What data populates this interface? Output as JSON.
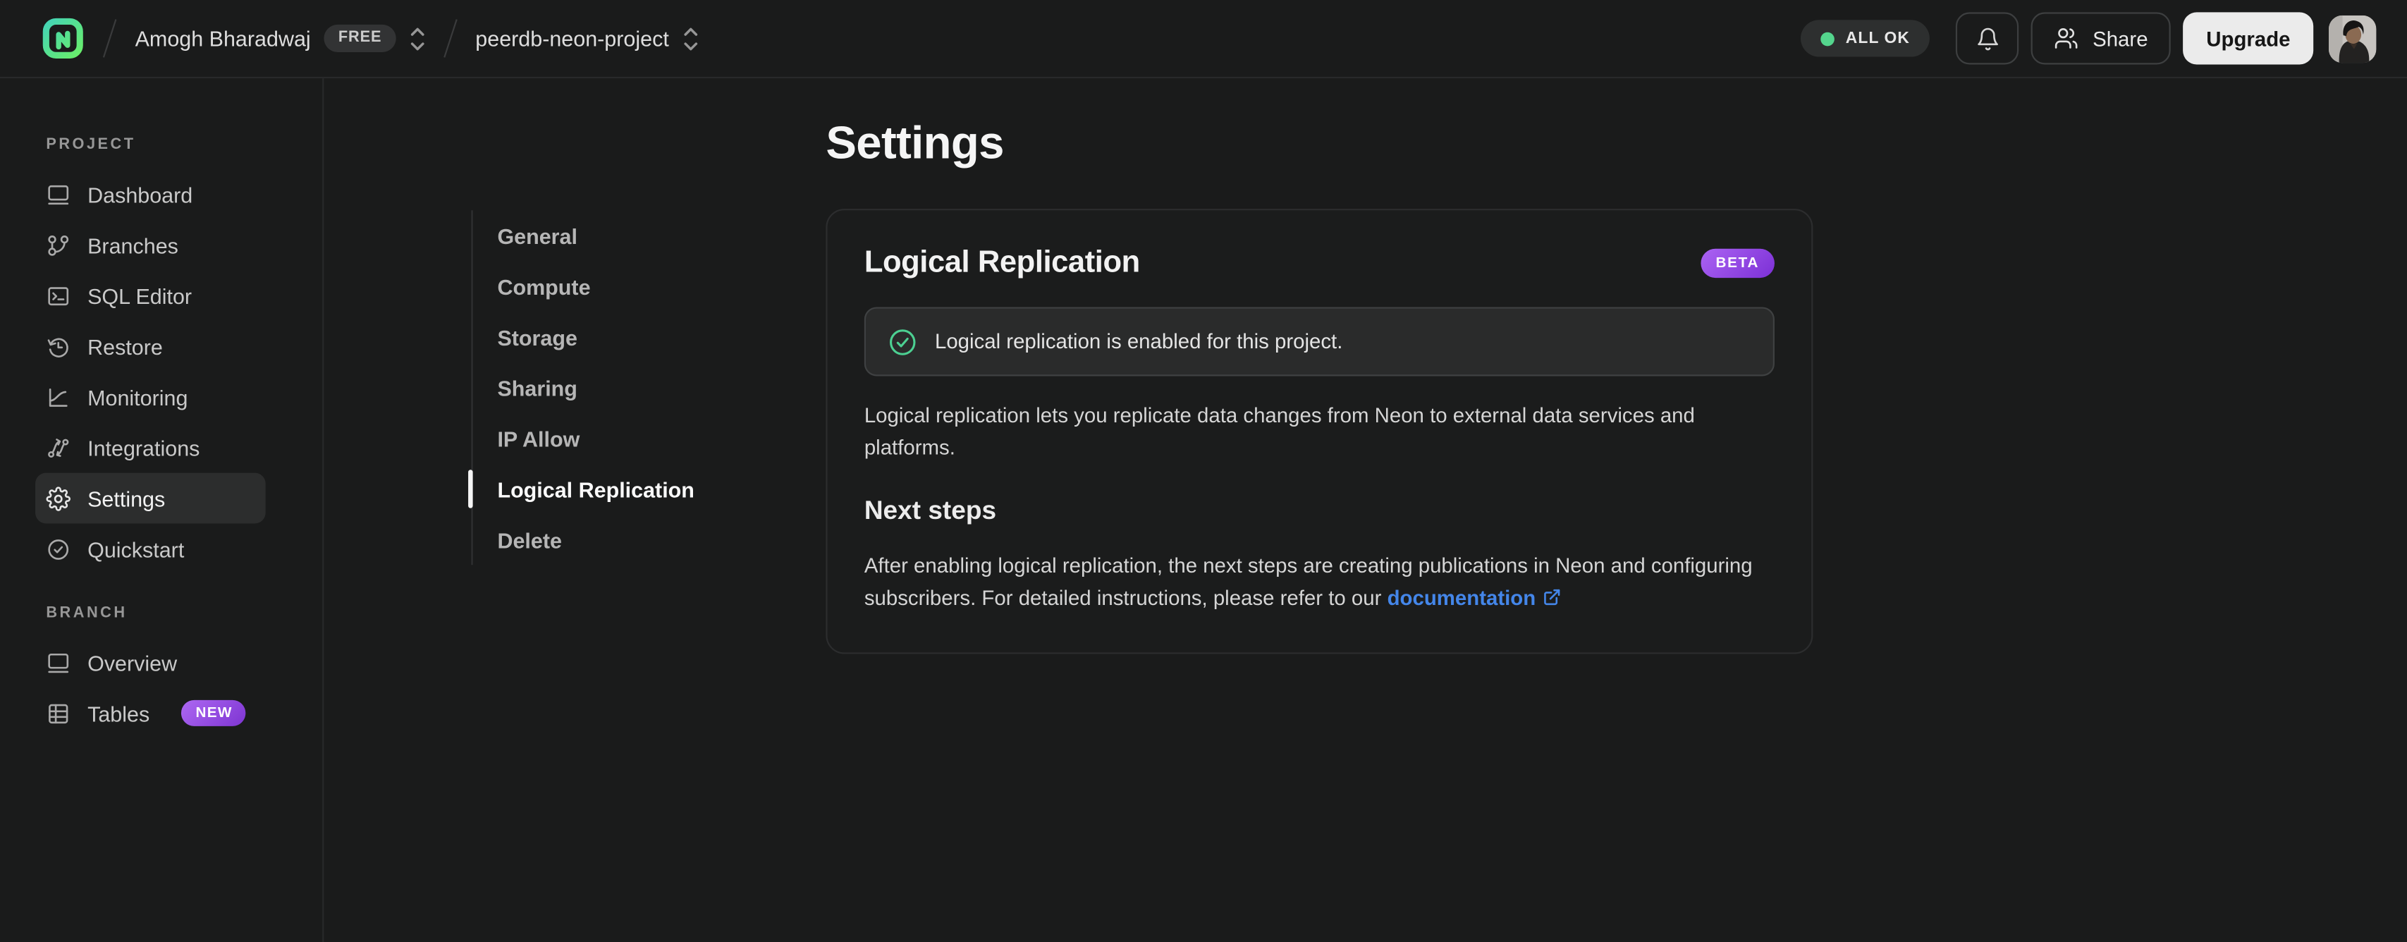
{
  "header": {
    "org_name": "Amogh Bharadwaj",
    "org_plan_badge": "FREE",
    "project_name": "peerdb-neon-project",
    "status_badge": "ALL OK",
    "share_label": "Share",
    "upgrade_label": "Upgrade"
  },
  "sidebar": {
    "project_section_label": "PROJECT",
    "project_items": [
      {
        "label": "Dashboard",
        "icon": "dashboard-icon",
        "active": false
      },
      {
        "label": "Branches",
        "icon": "branches-icon",
        "active": false
      },
      {
        "label": "SQL Editor",
        "icon": "sql-editor-icon",
        "active": false
      },
      {
        "label": "Restore",
        "icon": "restore-icon",
        "active": false
      },
      {
        "label": "Monitoring",
        "icon": "monitoring-icon",
        "active": false
      },
      {
        "label": "Integrations",
        "icon": "integrations-icon",
        "active": false
      },
      {
        "label": "Settings",
        "icon": "gear-icon",
        "active": true
      },
      {
        "label": "Quickstart",
        "icon": "check-circle-icon",
        "active": false
      }
    ],
    "branch_section_label": "BRANCH",
    "branch_items": [
      {
        "label": "Overview",
        "icon": "overview-icon",
        "badge": ""
      },
      {
        "label": "Tables",
        "icon": "tables-icon",
        "badge": "NEW"
      }
    ]
  },
  "settings_nav": {
    "items": [
      {
        "label": "General",
        "active": false
      },
      {
        "label": "Compute",
        "active": false
      },
      {
        "label": "Storage",
        "active": false
      },
      {
        "label": "Sharing",
        "active": false
      },
      {
        "label": "IP Allow",
        "active": false
      },
      {
        "label": "Logical Replication",
        "active": true
      },
      {
        "label": "Delete",
        "active": false
      }
    ]
  },
  "main": {
    "page_title": "Settings",
    "card": {
      "title": "Logical Replication",
      "beta_badge": "BETA",
      "alert_text": "Logical replication is enabled for this project.",
      "description": "Logical replication lets you replicate data changes from Neon to external data services and platforms.",
      "next_steps_title": "Next steps",
      "next_steps_text": "After enabling logical replication, the next steps are creating publications in Neon and configuring subscribers. For detailed instructions, please refer to our ",
      "link_label": "documentation"
    }
  },
  "colors": {
    "brand_green": "#00e599",
    "success_green": "#4cd092",
    "beta_purple": "#9a4bf0",
    "link_blue": "#4486e9",
    "background": "#1a1b1b"
  }
}
